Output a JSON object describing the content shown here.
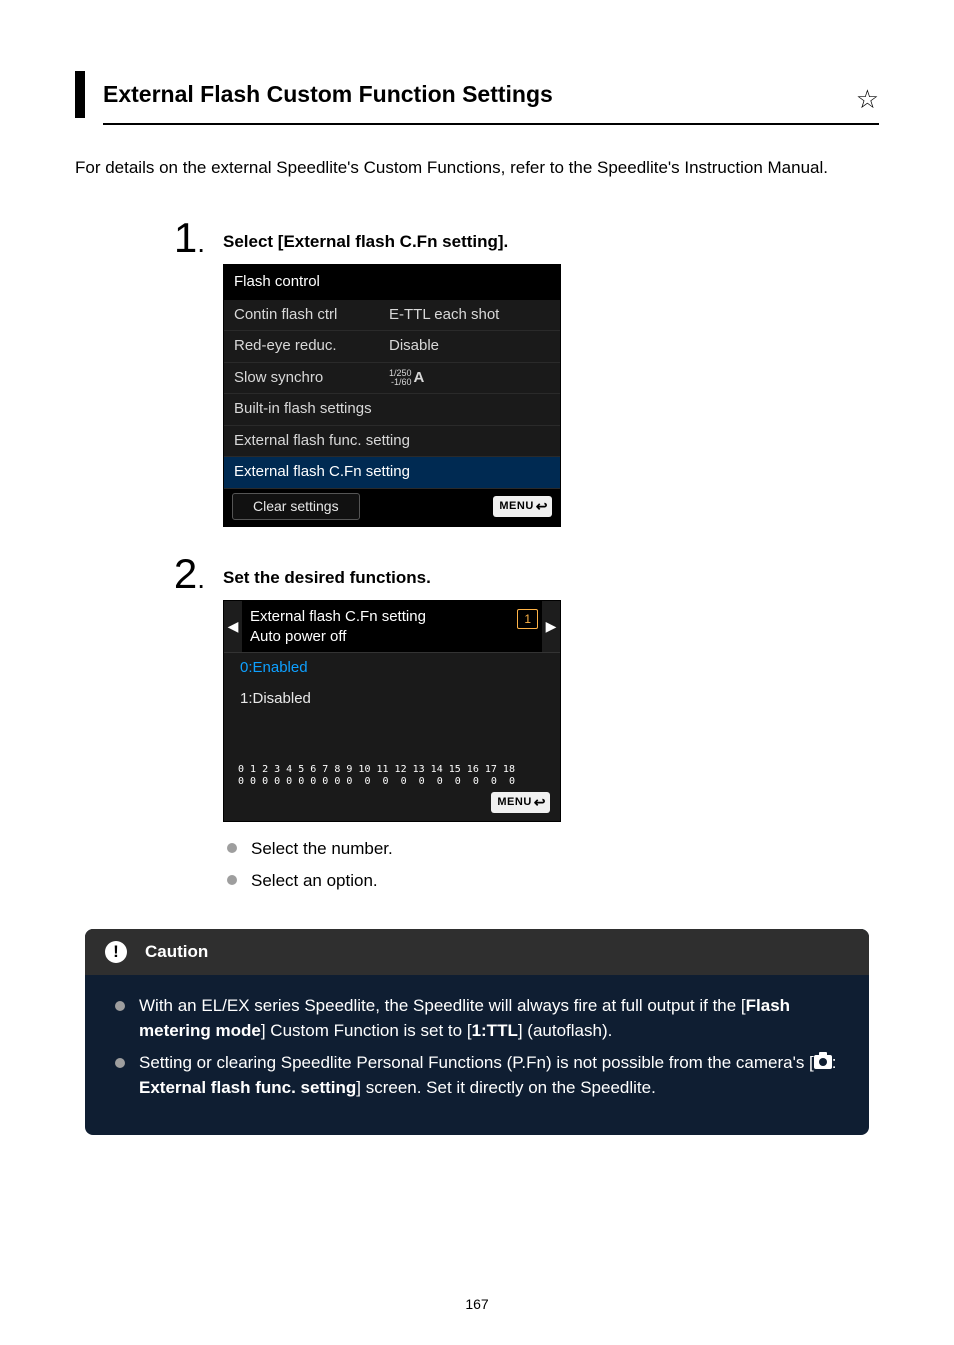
{
  "heading": "External Flash Custom Function Settings",
  "intro": "For details on the external Speedlite's Custom Functions, refer to the Speedlite's Instruction Manual.",
  "steps": {
    "s1": {
      "num": "1",
      "dot": ".",
      "title": "Select [External flash C.Fn setting].",
      "screen": {
        "header": "Flash control",
        "rows": [
          {
            "label": "Contin flash ctrl",
            "value": "E-TTL each shot"
          },
          {
            "label": "Red-eye reduc.",
            "value": "Disable"
          },
          {
            "label": "Slow synchro",
            "value_frac_top": "1/250",
            "value_frac_bot": "-1/60",
            "value_a": "A"
          },
          {
            "label": "Built-in flash settings",
            "value": ""
          },
          {
            "label": "External flash func. setting",
            "value": ""
          },
          {
            "label": "External flash C.Fn setting",
            "value": ""
          }
        ],
        "clear": "Clear settings",
        "menu": "MENU",
        "menu_ret": "↩"
      }
    },
    "s2": {
      "num": "2",
      "dot": ".",
      "title": "Set the desired functions.",
      "screen": {
        "left_arrow": "◀",
        "right_arrow": "▶",
        "title_line1": "External flash C.Fn setting",
        "title_line2": "Auto power off",
        "page_badge": "1",
        "opt_selected": "0:Enabled",
        "opt_other": "1:Disabled",
        "index_row1": " 0 1 2 3 4 5 6 7 8 9 10 11 12 13 14 15 16 17 18",
        "index_row2": " 0 0 0 0 0 0 0 0 0 0  0  0  0  0  0  0  0  0  0",
        "menu": "MENU",
        "menu_ret": "↩"
      },
      "bullets": [
        "Select the number.",
        "Select an option."
      ]
    }
  },
  "caution": {
    "header": "Caution",
    "items": {
      "i1": {
        "pre": "With an EL/EX series Speedlite, the Speedlite will always fire at full output if the [",
        "bold1": "Flash metering mode",
        "mid1": "] Custom Function is set to [",
        "bold2": "1:TTL",
        "post": "] (autoflash)."
      },
      "i2": {
        "pre": "Setting or clearing Speedlite Personal Functions (P.Fn) is not possible from the camera's [",
        "colon": ": ",
        "bold": "External flash func. setting",
        "post": "] screen. Set it directly on the Speedlite."
      }
    }
  },
  "page_number": "167"
}
